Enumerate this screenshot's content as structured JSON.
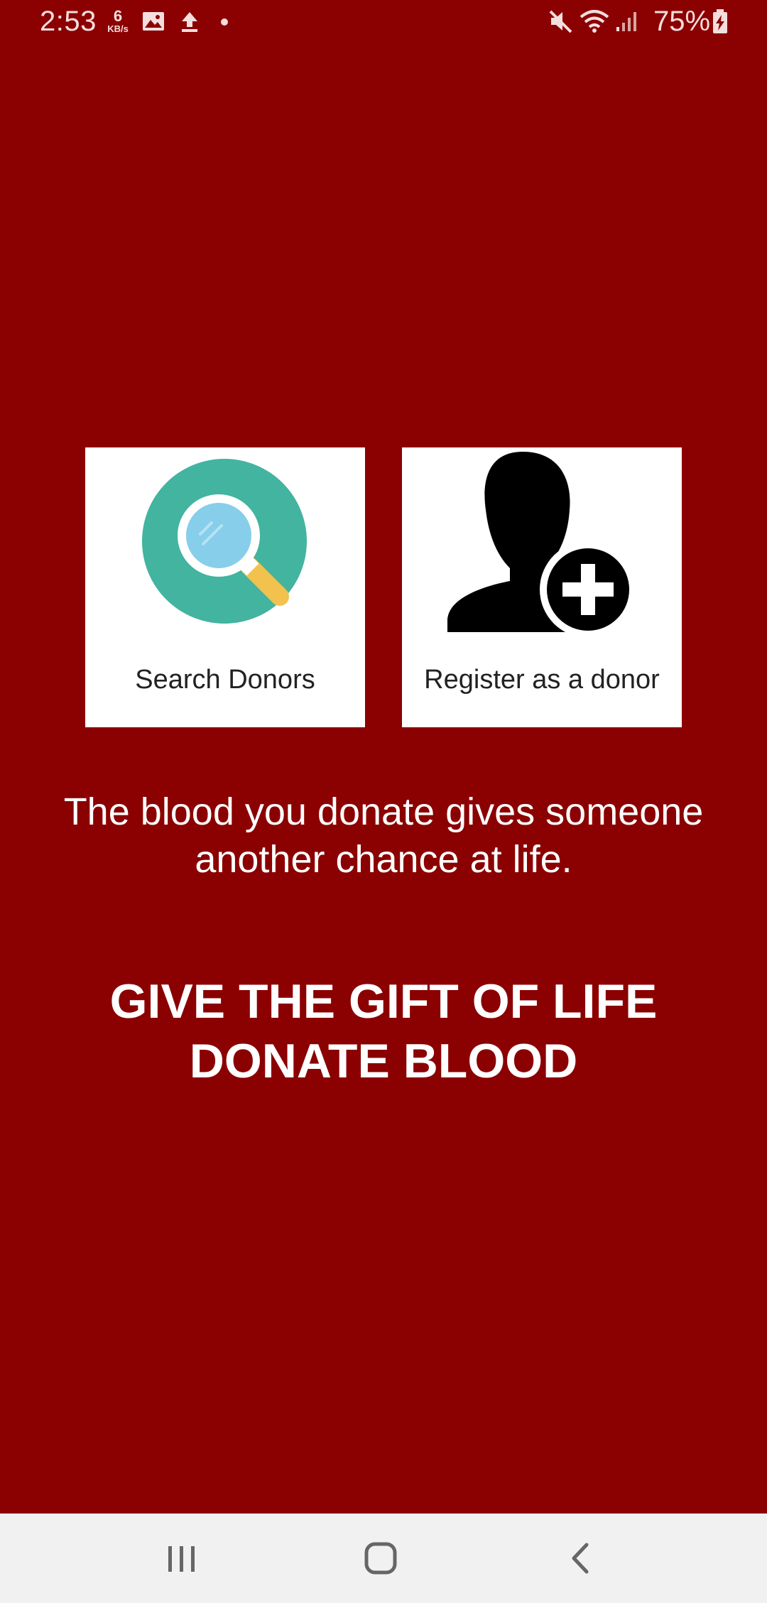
{
  "status_bar": {
    "time": "2:53",
    "network_speed_value": "6",
    "network_speed_unit": "KB/s",
    "battery_percent": "75%",
    "icons": [
      "image-icon",
      "upload-icon",
      "dot-icon",
      "mute-icon",
      "wifi-icon",
      "signal-icon",
      "battery-charging-icon"
    ]
  },
  "tiles": {
    "search": {
      "label": "Search Donors",
      "icon": "magnifier-icon"
    },
    "register": {
      "label": "Register as a donor",
      "icon": "add-user-icon"
    }
  },
  "tagline": {
    "line1": "The blood you donate gives someone",
    "line2": "another chance at life."
  },
  "slogan": {
    "line1": "GIVE THE GIFT OF LIFE",
    "line2": "DONATE BLOOD"
  },
  "nav_bar": {
    "buttons": [
      "recent-apps-icon",
      "home-icon",
      "back-icon"
    ]
  },
  "colors": {
    "background": "#8B0000",
    "tile": "#ffffff",
    "search_icon_circle": "#42B49F",
    "nav_bar": "#f1f1f1"
  }
}
